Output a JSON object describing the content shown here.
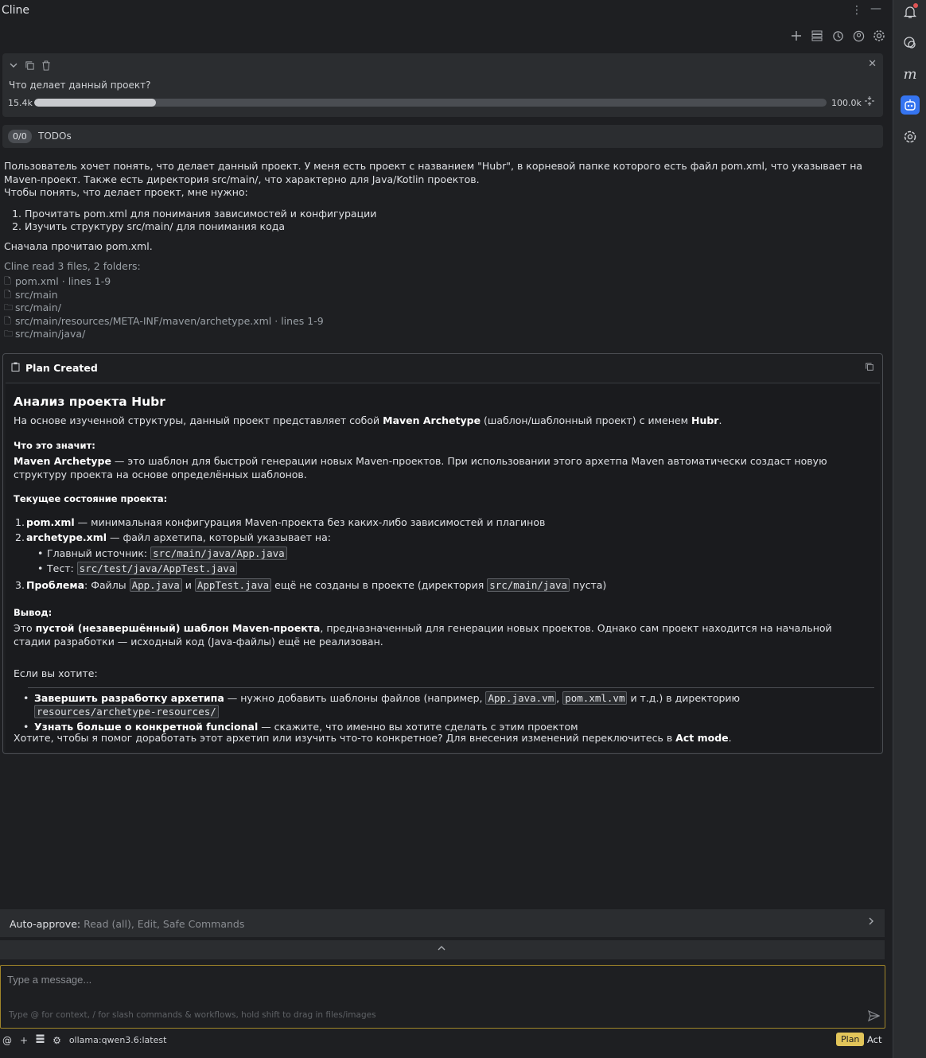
{
  "window": {
    "title": "Cline"
  },
  "task": {
    "question": "Что делает данный проект?",
    "tokens_used": "15.4k",
    "tokens_max": "100.0k",
    "progress_fraction": 0.154
  },
  "todos": {
    "count": "0/0",
    "label": "TODOs"
  },
  "message": {
    "para1": "Пользователь хочет понять, что делает данный проект. У меня есть проект с названием \"Hubr\", в корневой папке которого есть файл pom.xml, что указывает на Maven-проект. Также есть директория src/main/, что характерно для Java/Kotlin проектов.",
    "para2": "Чтобы понять, что делает проект, мне нужно:",
    "steps": [
      "Прочитать pom.xml для понимания зависимостей и конфигурации",
      "Изучить структуру src/main/ для понимания кода"
    ],
    "para3": "Сначала прочитаю pom.xml."
  },
  "reads": {
    "header": "Cline read 3 files, 2 folders:",
    "items": [
      "pom.xml · lines 1-9",
      "src/main",
      "src/main/",
      "src/main/resources/META-INF/maven/archetype.xml · lines 1-9",
      "src/main/java/"
    ]
  },
  "plan": {
    "header": "Plan Created",
    "title": "Анализ проекта Hubr",
    "intro_a": "На основе изученной структуры, данный проект представляет собой ",
    "intro_b": "Maven Archetype",
    "intro_c": " (шаблон/шаблонный проект) с именем ",
    "intro_d": "Hubr",
    "intro_e": ".",
    "h_meaning": "Что это значит:",
    "meaning_b": "Maven Archetype",
    "meaning_t": " — это шаблон для быстрой генерации новых Maven-проектов. При использовании этого архетпа Maven автоматически создаст новую структуру проекта на основе определённых шаблонов.",
    "h_state": "Текущее состояние проекта:",
    "s1_b": "pom.xml",
    "s1_t": " — минимальная конфигурация Maven-проекта без каких-либо зависимостей и плагинов",
    "s2_b": "archetype.xml",
    "s2_t": " — файл архетипа, который указывает на:",
    "s2_sub1_l": "Главный источник: ",
    "s2_sub1_c": "src/main/java/App.java",
    "s2_sub2_l": "Тест: ",
    "s2_sub2_c": "src/test/java/AppTest.java",
    "s3_b": "Проблема",
    "s3_t1": ": Файлы ",
    "s3_c1": "App.java",
    "s3_t2": " и ",
    "s3_c2": "AppTest.java",
    "s3_t3": " ещё не созданы в проекте (директория ",
    "s3_c3": "src/main/java",
    "s3_t4": " пуста)",
    "h_conc": "Вывод:",
    "conc_a": "Это ",
    "conc_b": "пустой (незавершённый) шаблон Maven-проекта",
    "conc_c": ", предназначенный для генерации новых проектов. Однако сам проект находится на начальной стадии разработки — исходный код (Java-файлы) ещё не реализован.",
    "if_you": "Если вы хотите:",
    "b1_b": "Завершить разработку архетипа",
    "b1_t1": " — нужно добавить шаблоны файлов (например, ",
    "b1_c1": "App.java.vm",
    "b1_t2": ", ",
    "b1_c2": "pom.xml.vm",
    "b1_t3": " и т.д.) в директорию ",
    "b1_c3": "resources/archetype-resources/",
    "b2_b": "Узнать больше о конкретной funcional",
    "b2_t": " — скажите, что именно вы хотите сделать с этим проектом",
    "outro_a": "Хотите, чтобы я помог доработать этот архетип или изучить что-то конкретное? Для внесения изменений переключитесь в ",
    "outro_b": "Act mode",
    "outro_c": "."
  },
  "auto_approve": {
    "label": "Auto-approve:",
    "value": "Read (all), Edit, Safe Commands"
  },
  "input": {
    "placeholder": "Type a message...",
    "hint": "Type @ for context, / for slash commands & workflows, hold shift to drag in files/images"
  },
  "bottom": {
    "model": "ollama:qwen3.6:latest",
    "plan_label": "Plan",
    "act_label": "Act"
  },
  "colors": {
    "accent_active": "#3574f0",
    "plan_badge": "#e2c55a",
    "input_border": "#a1862a"
  }
}
